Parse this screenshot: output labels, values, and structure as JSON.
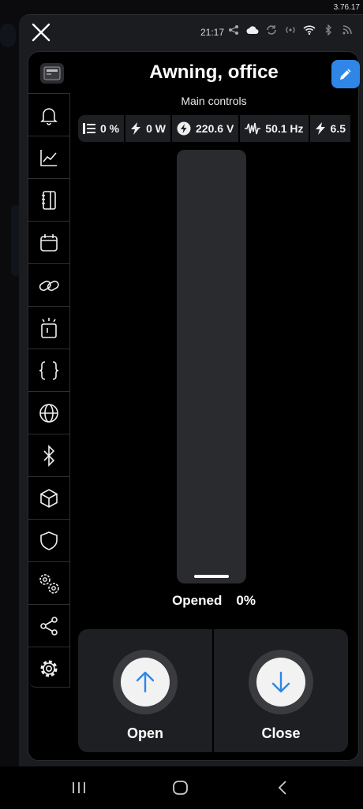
{
  "status_bar": {
    "version": "3.76.17",
    "time": "21:17"
  },
  "device": {
    "title": "Awning, office",
    "subtitle": "Main controls"
  },
  "stats": [
    {
      "icon": "position-icon",
      "value": "0 %"
    },
    {
      "icon": "bolt-icon",
      "value": "0 W"
    },
    {
      "icon": "voltage-icon",
      "value": "220.6 V"
    },
    {
      "icon": "frequency-icon",
      "value": "50.1 Hz"
    },
    {
      "icon": "bolt-icon",
      "value": "6.5"
    }
  ],
  "cover": {
    "state": "Opened",
    "position_label": "0%",
    "position_fraction": 0
  },
  "controls": {
    "open_label": "Open",
    "close_label": "Close"
  },
  "sidebar": {
    "items": [
      {
        "icon": "bell-icon"
      },
      {
        "icon": "chart-icon"
      },
      {
        "icon": "notebook-icon"
      },
      {
        "icon": "calendar-icon"
      },
      {
        "icon": "link-icon"
      },
      {
        "icon": "alarm-icon"
      },
      {
        "icon": "braces-icon"
      },
      {
        "icon": "globe-icon"
      },
      {
        "icon": "bluetooth-icon"
      },
      {
        "icon": "cube-icon"
      },
      {
        "icon": "shield-icon"
      },
      {
        "icon": "gears-icon"
      },
      {
        "icon": "share-icon"
      },
      {
        "icon": "settings-icon"
      }
    ]
  },
  "colors": {
    "accent": "#2f86e6",
    "arrow": "#2f86e6"
  }
}
